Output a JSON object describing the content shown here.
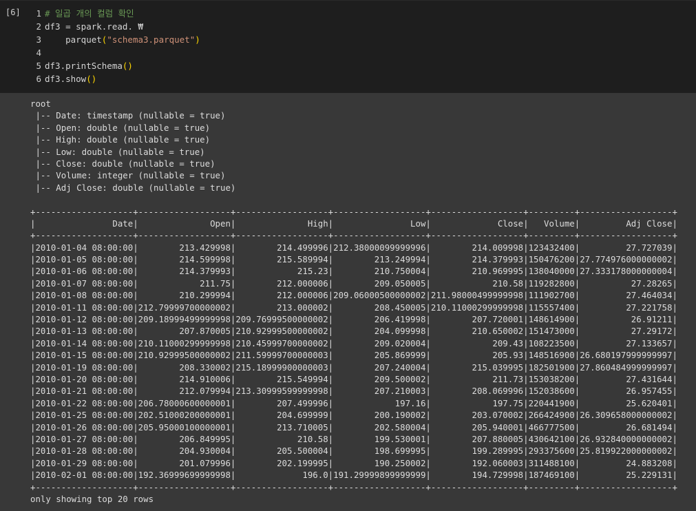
{
  "cell": {
    "execution_count": "[6]"
  },
  "editor": {
    "lines": [
      {
        "num": "1",
        "segments": [
          {
            "cls": "comment",
            "text": "# 일곱 개의 컬럼 확인"
          }
        ]
      },
      {
        "num": "2",
        "segments": [
          {
            "cls": "plain",
            "text": "df3 = spark.read. ₩"
          }
        ]
      },
      {
        "num": "3",
        "segments": [
          {
            "cls": "plain",
            "text": "    parquet"
          },
          {
            "cls": "paren",
            "text": "("
          },
          {
            "cls": "str",
            "text": "\"schema3.parquet\""
          },
          {
            "cls": "paren",
            "text": ")"
          }
        ]
      },
      {
        "num": "4",
        "segments": []
      },
      {
        "num": "5",
        "segments": [
          {
            "cls": "plain",
            "text": "df3.printSchema"
          },
          {
            "cls": "paren",
            "text": "()"
          }
        ]
      },
      {
        "num": "6",
        "segments": [
          {
            "cls": "plain",
            "text": "df3.show"
          },
          {
            "cls": "paren",
            "text": "()"
          }
        ]
      }
    ]
  },
  "output": {
    "schema_lines": [
      "root",
      " |-- Date: timestamp (nullable = true)",
      " |-- Open: double (nullable = true)",
      " |-- High: double (nullable = true)",
      " |-- Low: double (nullable = true)",
      " |-- Close: double (nullable = true)",
      " |-- Volume: integer (nullable = true)",
      " |-- Adj Close: double (nullable = true)",
      ""
    ],
    "table": {
      "border": "+-------------------+------------------+------------------+------------------+------------------+---------+------------------+",
      "header": "|               Date|              Open|              High|               Low|             Close|   Volume|         Adj Close|",
      "rows": [
        "|2010-01-04 08:00:00|        213.429998|        214.499996|212.38000099999996|        214.009998|123432400|         27.727039|",
        "|2010-01-05 08:00:00|        214.599998|        215.589994|        213.249994|        214.379993|150476200|27.774976000000002|",
        "|2010-01-06 08:00:00|        214.379993|            215.23|        210.750004|        210.969995|138040000|27.333178000000004|",
        "|2010-01-07 08:00:00|            211.75|        212.000006|        209.050005|            210.58|119282800|          27.28265|",
        "|2010-01-08 08:00:00|        210.299994|        212.000006|209.06000500000002|211.98000499999998|111902700|         27.464034|",
        "|2010-01-11 08:00:00|212.79999700000002|        213.000002|        208.450005|210.11000299999998|115557400|         27.221758|",
        "|2010-01-12 08:00:00|209.18999499999998|209.76999500000002|        206.419998|        207.720001|148614900|          26.91211|",
        "|2010-01-13 08:00:00|        207.870005|210.92999500000002|        204.099998|        210.650002|151473000|          27.29172|",
        "|2010-01-14 08:00:00|210.11000299999998|210.45999700000002|        209.020004|            209.43|108223500|         27.133657|",
        "|2010-01-15 08:00:00|210.92999500000002|211.59999700000003|        205.869999|            205.93|148516900|26.680197999999997|",
        "|2010-01-19 08:00:00|        208.330002|215.18999900000003|        207.240004|        215.039995|182501900|27.860484999999997|",
        "|2010-01-20 08:00:00|        214.910006|        215.549994|        209.500002|            211.73|153038200|         27.431644|",
        "|2010-01-21 08:00:00|        212.079994|213.30999599999998|        207.210003|        208.069996|152038600|         26.957455|",
        "|2010-01-22 08:00:00|206.78000600000001|        207.499996|            197.16|            197.75|220441900|         25.620401|",
        "|2010-01-25 08:00:00|202.51000200000001|        204.699999|        200.190002|        203.070002|266424900|26.309658000000002|",
        "|2010-01-26 08:00:00|205.95000100000001|        213.710005|        202.580004|        205.940001|466777500|         26.681494|",
        "|2010-01-27 08:00:00|        206.849995|            210.58|        199.530001|        207.880005|430642100|26.932840000000002|",
        "|2010-01-28 08:00:00|        204.930004|        205.500004|        198.699995|        199.289995|293375600|25.819922000000002|",
        "|2010-01-29 08:00:00|        201.079996|        202.199995|        190.250002|        192.060003|311488100|         24.883208|",
        "|2010-02-01 08:00:00|192.36999699999998|             196.0|191.29999899999999|        194.729998|187469100|         25.229131|"
      ]
    },
    "footer": "only showing top 20 rows"
  }
}
